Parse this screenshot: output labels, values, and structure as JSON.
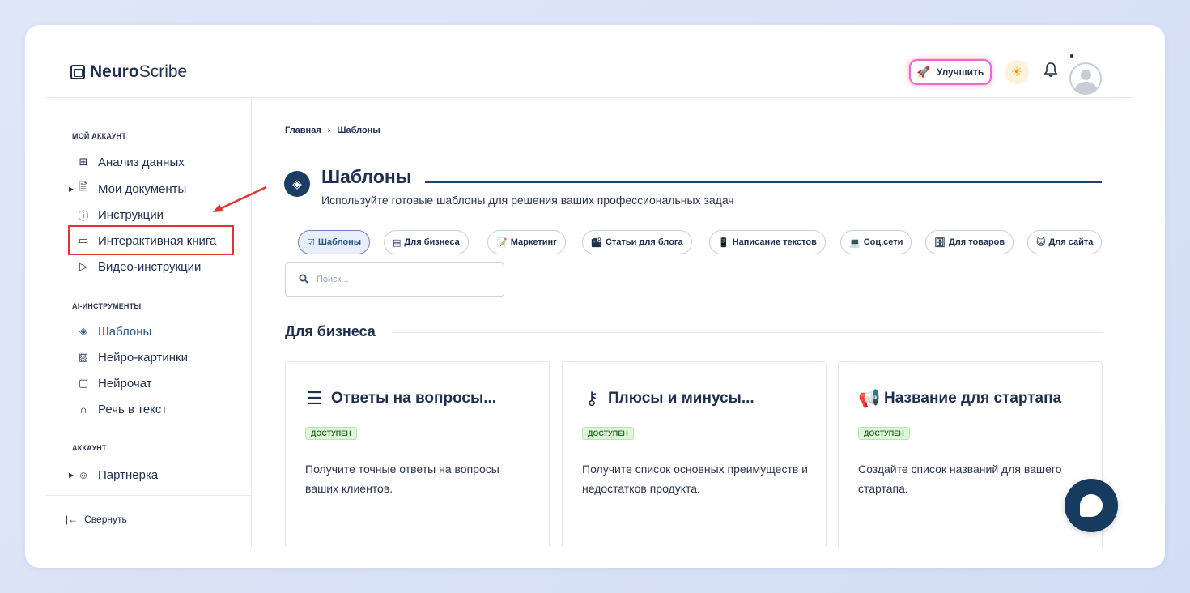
{
  "header": {
    "logo_bold": "Neuro",
    "logo_rest": "Scribe",
    "upgrade_label": "Улучшить"
  },
  "sidebar": {
    "section_account": "МОЙ АККАУНТ",
    "account_items": [
      {
        "label": "Анализ данных",
        "icon": "grid-icon"
      },
      {
        "label": "Мои документы",
        "icon": "document-icon"
      },
      {
        "label": "Инструкции",
        "icon": "help-circle-icon"
      },
      {
        "label": "Интерактивная книга",
        "icon": "book-icon"
      },
      {
        "label": "Видео-инструкции",
        "icon": "video-icon"
      }
    ],
    "section_ai": "AI-ИНСТРУМЕНТЫ",
    "ai_items": [
      {
        "label": "Шаблоны",
        "icon": "layers-icon"
      },
      {
        "label": "Нейро-картинки",
        "icon": "image-icon"
      },
      {
        "label": "Нейрочат",
        "icon": "chat-icon"
      },
      {
        "label": "Речь в текст",
        "icon": "headphones-icon"
      }
    ],
    "section_acc2": "АККАУНТ",
    "acc2_items": [
      {
        "label": "Партнерка",
        "icon": "users-icon"
      }
    ],
    "collapse_label": "Свернуть"
  },
  "main": {
    "breadcrumb": [
      "Главная",
      "Шаблоны"
    ],
    "title": "Шаблоны",
    "subtitle": "Используйте готовые шаблоны для решения ваших профессиональных задач",
    "chips": [
      {
        "label": "Шаблоны",
        "icon": "☑",
        "active": true
      },
      {
        "label": "Для бизнеса",
        "icon": "▤"
      },
      {
        "label": "Маркетинг",
        "icon": "📝"
      },
      {
        "label": "Статьи для блога",
        "icon": "🏙"
      },
      {
        "label": "Написание текстов",
        "icon": "📱"
      },
      {
        "label": "Соц.сети",
        "icon": "💻"
      },
      {
        "label": "Для товаров",
        "icon": "🗄"
      },
      {
        "label": "Для сайта",
        "icon": "😺"
      }
    ],
    "search_placeholder": "Поиск...",
    "section_title": "Для бизнеса",
    "cards": [
      {
        "title": "Ответы на вопросы...",
        "badge": "ДОСТУПЕН",
        "desc": "Получите точные ответы на вопросы ваших клиентов.",
        "icon": "list-icon"
      },
      {
        "title": "Плюсы и минусы...",
        "badge": "ДОСТУПЕН",
        "desc": "Получите список основных преимуществ и недостатков продукта.",
        "icon": "key-icon"
      },
      {
        "title": "Название для стартапа",
        "badge": "ДОСТУПЕН",
        "desc": "Создайте список названий для вашего стартапа.",
        "icon": "megaphone-icon"
      }
    ]
  },
  "colors": {
    "accent": "#1b3d63",
    "highlight": "#e2342f",
    "badge_bg": "#dcf7d6"
  }
}
